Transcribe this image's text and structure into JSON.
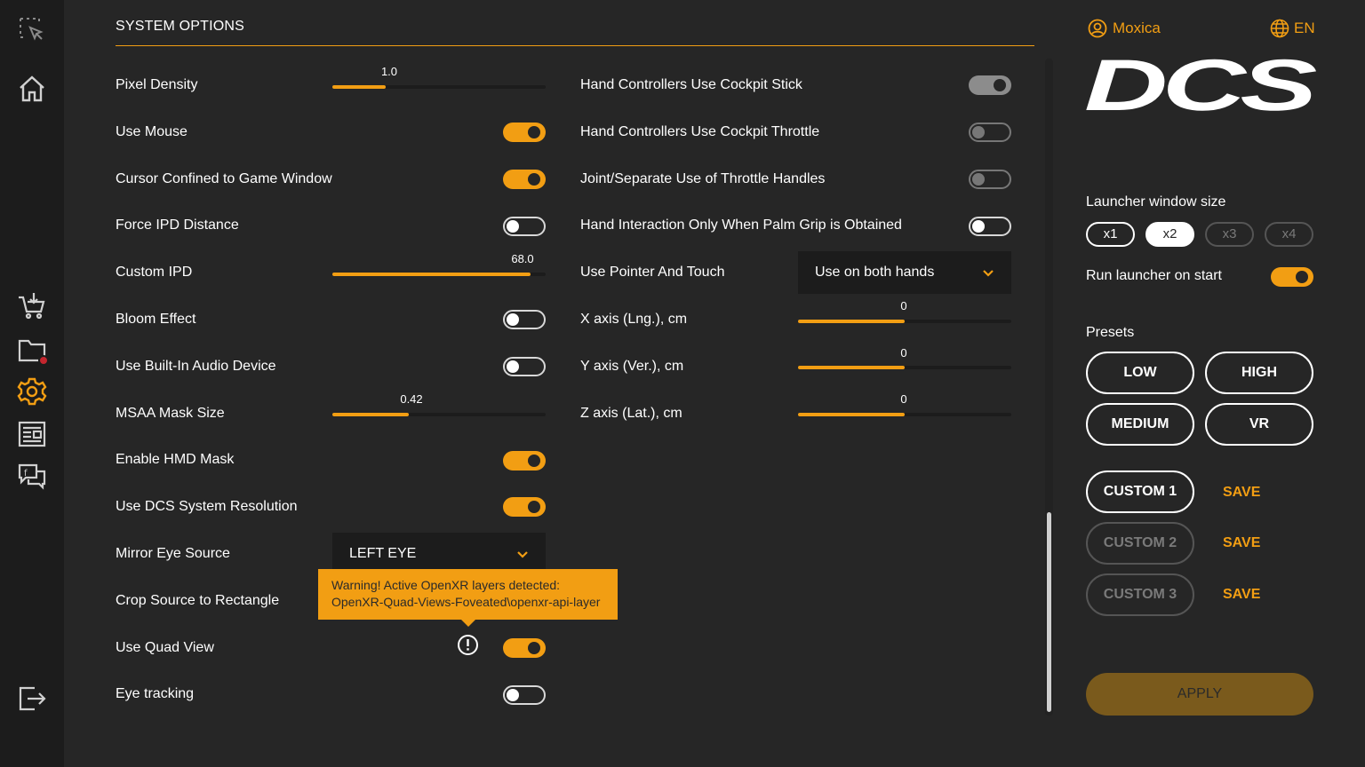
{
  "section_title": "SYSTEM OPTIONS",
  "colors": {
    "accent": "#f29e13",
    "background": "#262626",
    "sidebar": "#1c1c1c"
  },
  "sidebar": {
    "icons": [
      "select-cursor-icon",
      "home-icon",
      "shop-cart-icon",
      "folder-icon",
      "gear-icon",
      "news-icon",
      "social-chat-icon",
      "logout-icon"
    ]
  },
  "left": {
    "pixel_density": {
      "label": "Pixel Density",
      "value": "1.0",
      "fill": 0.25
    },
    "use_mouse": {
      "label": "Use Mouse",
      "on": true
    },
    "cursor_confined": {
      "label": "Cursor Confined to Game Window",
      "on": true
    },
    "force_ipd": {
      "label": "Force IPD Distance",
      "on": false
    },
    "custom_ipd": {
      "label": "Custom IPD",
      "value": "68.0",
      "fill": 0.93
    },
    "bloom": {
      "label": "Bloom Effect",
      "on": false
    },
    "audio": {
      "label": "Use Built-In Audio Device",
      "on": false
    },
    "msaa": {
      "label": "MSAA Mask Size",
      "value": "0.42",
      "fill": 0.36
    },
    "hmd_mask": {
      "label": "Enable HMD Mask",
      "on": true
    },
    "dcs_resolution": {
      "label": "Use DCS System Resolution",
      "on": true
    },
    "mirror_eye": {
      "label": "Mirror Eye Source",
      "value": "LEFT EYE"
    },
    "crop_source": {
      "label": "Crop Source to Rectangle"
    },
    "quad_view": {
      "label": "Use Quad View",
      "on": true
    },
    "eye_tracking": {
      "label": "Eye tracking",
      "on": false
    }
  },
  "tooltip": {
    "line1": "Warning! Active OpenXR layers detected:",
    "line2": "OpenXR-Quad-Views-Foveated\\openxr-api-layer"
  },
  "right": {
    "cockpit_stick": {
      "label": "Hand Controllers Use Cockpit Stick",
      "on": true
    },
    "cockpit_throttle": {
      "label": "Hand Controllers Use Cockpit Throttle",
      "on": false
    },
    "throttle_handles": {
      "label": "Joint/Separate Use of Throttle Handles",
      "on": false
    },
    "palm_grip": {
      "label": "Hand Interaction Only When Palm Grip is Obtained",
      "on": false
    },
    "pointer_touch": {
      "label": "Use Pointer And Touch",
      "value": "Use on both hands"
    },
    "x_axis": {
      "label": "X axis (Lng.), cm",
      "value": "0",
      "fill": 0.5
    },
    "y_axis": {
      "label": "Y axis (Ver.), cm",
      "value": "0",
      "fill": 0.5
    },
    "z_axis": {
      "label": "Z axis (Lat.), cm",
      "value": "0",
      "fill": 0.5
    }
  },
  "panel": {
    "username": "Moxica",
    "language": "EN",
    "logo_text": "DCS",
    "window_size_label": "Launcher window size",
    "sizes": [
      "x1",
      "x2",
      "x3",
      "x4"
    ],
    "selected_size": "x2",
    "run_on_start_label": "Run launcher on start",
    "run_on_start": true,
    "presets_label": "Presets",
    "presets": [
      "LOW",
      "HIGH",
      "MEDIUM",
      "VR"
    ],
    "custom": [
      "CUSTOM 1",
      "CUSTOM 2",
      "CUSTOM 3"
    ],
    "save_label": "SAVE",
    "apply_label": "APPLY"
  }
}
